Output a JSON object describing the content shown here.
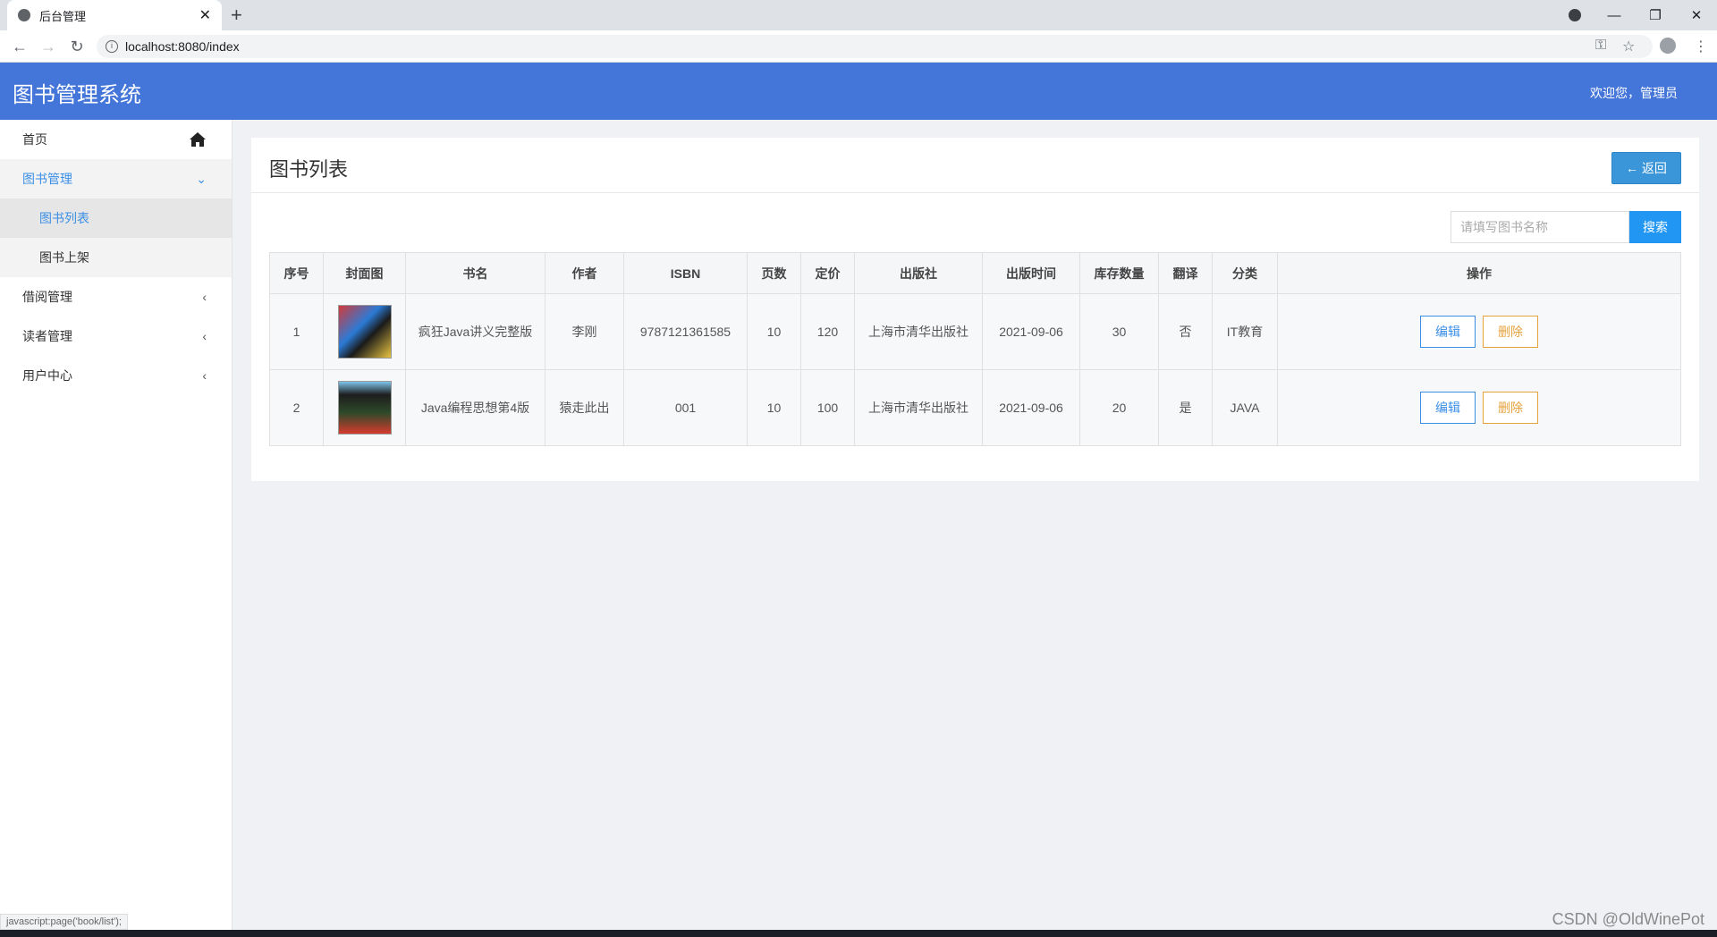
{
  "browser": {
    "tab_title": "后台管理",
    "url": "localhost:8080/index"
  },
  "header": {
    "logo": "图书管理系统",
    "welcome": "欢迎您，管理员"
  },
  "sidebar": {
    "items": [
      {
        "label": "首页"
      },
      {
        "label": "图书管理"
      },
      {
        "label": "图书列表"
      },
      {
        "label": "图书上架"
      },
      {
        "label": "借阅管理"
      },
      {
        "label": "读者管理"
      },
      {
        "label": "用户中心"
      }
    ]
  },
  "panel": {
    "title": "图书列表",
    "back_label": "← 返回",
    "search_placeholder": "请填写图书名称",
    "search_label": "搜索"
  },
  "table": {
    "headers": [
      "序号",
      "封面图",
      "书名",
      "作者",
      "ISBN",
      "页数",
      "定价",
      "出版社",
      "出版时间",
      "库存数量",
      "翻译",
      "分类",
      "操作"
    ],
    "rows": [
      {
        "no": "1",
        "name": "疯狂Java讲义完整版",
        "author": "李刚",
        "isbn": "9787121361585",
        "pages": "10",
        "price": "120",
        "publisher": "上海市清华出版社",
        "date": "2021-09-06",
        "stock": "30",
        "translated": "否",
        "category": "IT教育",
        "edit": "编辑",
        "delete": "删除"
      },
      {
        "no": "2",
        "name": "Java编程思想第4版",
        "author": "猿走此出",
        "isbn": "001",
        "pages": "10",
        "price": "100",
        "publisher": "上海市清华出版社",
        "date": "2021-09-06",
        "stock": "20",
        "translated": "是",
        "category": "JAVA",
        "edit": "编辑",
        "delete": "删除"
      }
    ]
  },
  "status_bar": "javascript:page('book/list');",
  "watermark": "CSDN @OldWinePot"
}
